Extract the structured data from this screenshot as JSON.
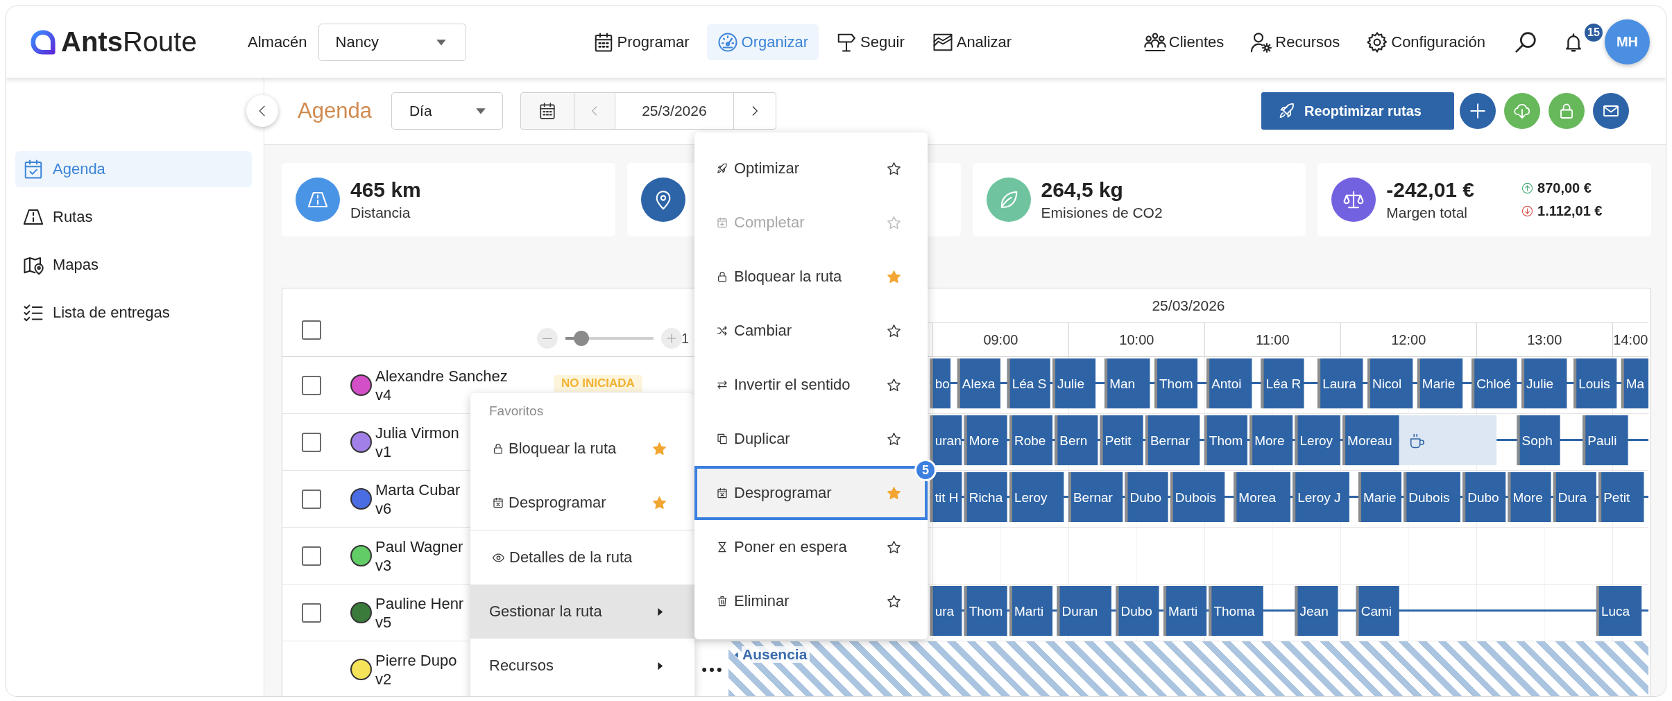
{
  "header": {
    "logo": "**Ants**Route",
    "warehouse": {
      "label": "Almacén",
      "value": "Nancy"
    },
    "nav": [
      {
        "label": "Programar",
        "selected": false
      },
      {
        "label": "Organizar",
        "selected": true
      },
      {
        "label": "Seguir",
        "selected": false
      },
      {
        "label": "Analizar",
        "selected": false
      }
    ],
    "links": [
      {
        "label": "Clientes"
      },
      {
        "label": "Recursos"
      },
      {
        "label": "Configuración"
      }
    ],
    "notifications": "15",
    "avatar": "MH"
  },
  "sidebar": {
    "items": [
      {
        "label": "Agenda",
        "selected": true
      },
      {
        "label": "Rutas",
        "selected": false
      },
      {
        "label": "Mapas",
        "selected": false
      },
      {
        "label": "Lista de entregas",
        "selected": false
      }
    ]
  },
  "toolbar": {
    "title": "Agenda",
    "view": "Día",
    "date": "25/3/2026",
    "primary_button": "Reoptimizar rutas",
    "icon_buttons": [
      {
        "color": "#2d64a8"
      },
      {
        "color": "#67b85b"
      },
      {
        "color": "#67b85b"
      },
      {
        "color": "#2d64a8"
      }
    ]
  },
  "stats": [
    {
      "color": "#4a94e6",
      "value": "465 km",
      "label": "Distancia"
    },
    {
      "color": "#2d64a8"
    },
    {
      "color": "#6fc49f",
      "value": "264,5 kg",
      "label": "Emisiones de CO2"
    },
    {
      "color": "#7362e0",
      "value": "-242,01 €",
      "label": "Margen total",
      "up": "870,00 €",
      "down": "1.112,01 €"
    }
  ],
  "planning": {
    "select_all": {
      "checked": false
    },
    "zoom": {
      "level": 0.18,
      "value": "1"
    },
    "date": "25/03/2026",
    "hours": [
      "09:00",
      "10:00",
      "11:00",
      "12:00",
      "13:00",
      "14:00"
    ],
    "routes": [
      {
        "name": "Alexandre Sanchez",
        "vehicle": "v4",
        "color": "#d34fc7",
        "checked": false,
        "menu_open": false,
        "status": "NO INICIADA",
        "visits": [
          {
            "kind": "visit",
            "label": "bo"
          },
          {
            "kind": "visit",
            "label": "Alexa"
          },
          {
            "kind": "visit",
            "label": "Léa S"
          },
          {
            "kind": "visit",
            "label": "Julie"
          },
          {
            "kind": "visit",
            "label": "Man"
          },
          {
            "kind": "visit",
            "label": "Thom"
          },
          {
            "kind": "visit",
            "label": "Antoi"
          },
          {
            "kind": "visit",
            "label": "Léa R"
          },
          {
            "kind": "visit",
            "label": "Laura"
          },
          {
            "kind": "visit",
            "label": "Nicol"
          },
          {
            "kind": "visit",
            "label": "Marie"
          },
          {
            "kind": "visit",
            "label": "Chloé"
          },
          {
            "kind": "visit",
            "label": "Julie"
          },
          {
            "kind": "visit",
            "label": "Louis"
          },
          {
            "kind": "visit",
            "label": "Ma"
          }
        ]
      },
      {
        "name": "Julia Virmon",
        "vehicle": "v1",
        "color": "#a181e8",
        "checked": false,
        "menu_open": false,
        "visits": [
          {
            "kind": "visit",
            "label": "uran"
          },
          {
            "kind": "visit",
            "label": "More"
          },
          {
            "kind": "visit",
            "label": "Robe"
          },
          {
            "kind": "visit",
            "label": "Bern"
          },
          {
            "kind": "visit",
            "label": "Petit"
          },
          {
            "kind": "visit",
            "label": "Bernar"
          },
          {
            "kind": "visit",
            "label": "Thom"
          },
          {
            "kind": "visit",
            "label": "More"
          },
          {
            "kind": "visit",
            "label": "Leroy"
          },
          {
            "kind": "visit",
            "label": "Moreau"
          },
          {
            "kind": "break"
          },
          {
            "kind": "visit",
            "label": "Soph"
          },
          {
            "kind": "visit",
            "label": "Pauli"
          }
        ]
      },
      {
        "name": "Marta Cubar",
        "vehicle": "v6",
        "color": "#4a6de3",
        "checked": false,
        "menu_open": false,
        "visits": [
          {
            "kind": "visit",
            "label": "tit H"
          },
          {
            "kind": "visit",
            "label": "Richa"
          },
          {
            "kind": "visit",
            "label": "Leroy"
          },
          {
            "kind": "visit",
            "label": "Bernar"
          },
          {
            "kind": "visit",
            "label": "Dubo"
          },
          {
            "kind": "visit",
            "label": "Dubois"
          },
          {
            "kind": "visit",
            "label": "Morea"
          },
          {
            "kind": "visit",
            "label": "Leroy J"
          },
          {
            "kind": "visit",
            "label": "Marie"
          },
          {
            "kind": "visit",
            "label": "Dubois"
          },
          {
            "kind": "visit",
            "label": "Dubo"
          },
          {
            "kind": "visit",
            "label": "More"
          },
          {
            "kind": "visit",
            "label": "Dura"
          },
          {
            "kind": "visit",
            "label": "Petit"
          }
        ]
      },
      {
        "name": "Paul Wagner",
        "vehicle": "v3",
        "color": "#62cc66",
        "checked": false,
        "menu_open": false
      },
      {
        "name": "Pauline Henr",
        "vehicle": "v5",
        "color": "#3a7a3a",
        "checked": false,
        "menu_open": false,
        "visits": [
          {
            "kind": "visit",
            "label": "ura"
          },
          {
            "kind": "visit",
            "label": "Thom"
          },
          {
            "kind": "visit",
            "label": "Marti"
          },
          {
            "kind": "visit",
            "label": "Duran"
          },
          {
            "kind": "visit",
            "label": "Dubo"
          },
          {
            "kind": "visit",
            "label": "Marti"
          },
          {
            "kind": "visit",
            "label": "Thoma"
          },
          {
            "kind": "visit",
            "label": "Jean"
          },
          {
            "kind": "visit",
            "label": "Cami"
          },
          {
            "kind": "visit",
            "label": "Luca"
          }
        ]
      },
      {
        "name": "Pierre Dupo",
        "vehicle": "v2",
        "color": "#f5e35a",
        "menu_open": true,
        "absence": "Ausencia"
      }
    ]
  },
  "context_menu": {
    "header": "Favoritos",
    "favorites": [
      {
        "label": "Bloquear la ruta",
        "favorite": true,
        "selected": false
      },
      {
        "label": "Desprogramar",
        "favorite": true,
        "selected": false
      }
    ],
    "items": [
      {
        "label": "Detalles de la ruta",
        "submenu": false,
        "selected": false
      },
      {
        "label": "Gestionar la ruta",
        "submenu": true,
        "selected": true
      },
      {
        "label": "Recursos",
        "submenu": true,
        "selected": false
      }
    ]
  },
  "submenu": {
    "items": [
      {
        "label": "Optimizar",
        "favorite": false,
        "disabled": false,
        "selected": false
      },
      {
        "label": "Completar",
        "favorite": false,
        "disabled": true,
        "selected": false
      },
      {
        "label": "Bloquear la ruta",
        "favorite": true,
        "disabled": false,
        "selected": false
      },
      {
        "label": "Cambiar",
        "favorite": false,
        "disabled": false,
        "selected": false
      },
      {
        "label": "Invertir el sentido",
        "favorite": false,
        "disabled": false,
        "selected": false
      },
      {
        "label": "Duplicar",
        "favorite": false,
        "disabled": false,
        "selected": false
      },
      {
        "label": "Desprogramar",
        "favorite": true,
        "disabled": false,
        "selected": true,
        "badge": "5"
      },
      {
        "label": "Poner en espera",
        "favorite": false,
        "disabled": false,
        "selected": false
      },
      {
        "label": "Eliminar",
        "favorite": false,
        "disabled": false,
        "selected": false
      }
    ]
  }
}
